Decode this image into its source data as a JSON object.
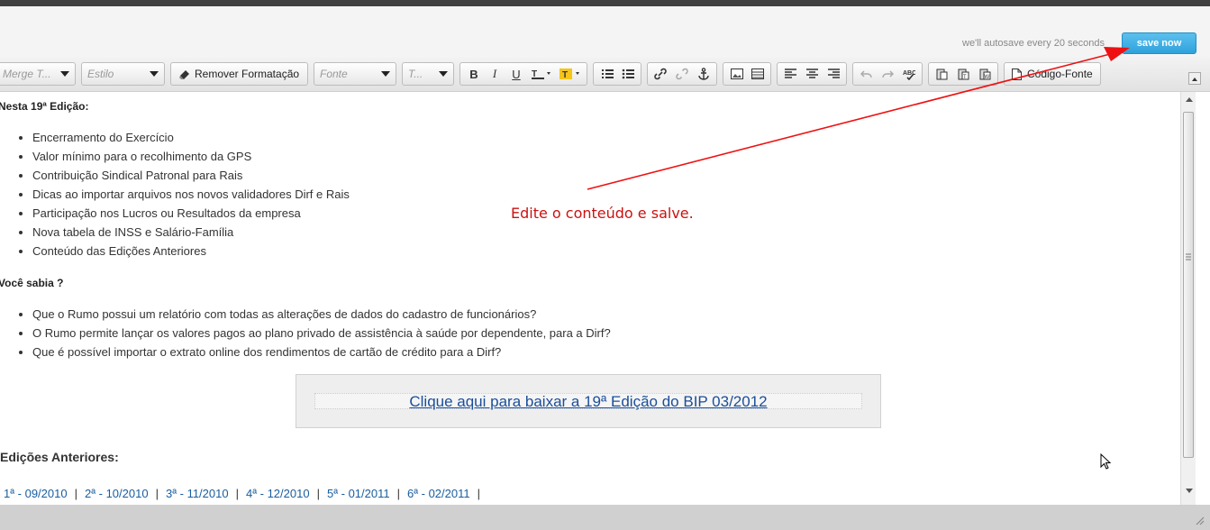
{
  "header": {
    "autosave_text": "we'll autosave every 20 seconds",
    "save_label": "save now"
  },
  "toolbar": {
    "merge_tags_placeholder": "Merge T...",
    "style_placeholder": "Estilo",
    "remove_format_label": "Remover Formatação",
    "font_placeholder": "Fonte",
    "size_placeholder": "T...",
    "bold": "B",
    "italic": "I",
    "underline": "U",
    "source_label": "Código-Fonte"
  },
  "content": {
    "section1_title": "Nesta 19ª Edição:",
    "section1_items": [
      "Encerramento do Exercício",
      "Valor mínimo para o recolhimento da GPS",
      "Contribuição Sindical Patronal para Rais",
      "Dicas ao importar arquivos nos novos validadores Dirf e Rais",
      "Participação nos Lucros ou Resultados da empresa",
      "Nova tabela de INSS e Salário-Família",
      "Conteúdo das Edições Anteriores"
    ],
    "section2_title": "Você sabia ?",
    "section2_items": [
      "Que o Rumo possui um relatório com todas as alterações de dados do cadastro de funcionários?",
      "O Rumo permite lançar os valores pagos ao plano privado de assistência à saúde por dependente, para a Dirf?",
      "Que é possível importar o extrato online dos rendimentos de cartão de crédito para a Dirf?"
    ],
    "download_link": "Clique aqui para baixar a 19ª Edição do BIP 03/2012",
    "previous_title": "Edições Anteriores:",
    "editions": [
      "1ª - 09/2010",
      "2ª - 10/2010",
      "3ª - 11/2010",
      "4ª - 12/2010",
      "5ª - 01/2011",
      "6ª - 02/2011"
    ]
  },
  "annotation": {
    "text": "Edite o conteúdo e salve.",
    "color": "#cc1111"
  },
  "colors": {
    "accent": "#2ea2dc",
    "link": "#1a5ea0"
  }
}
